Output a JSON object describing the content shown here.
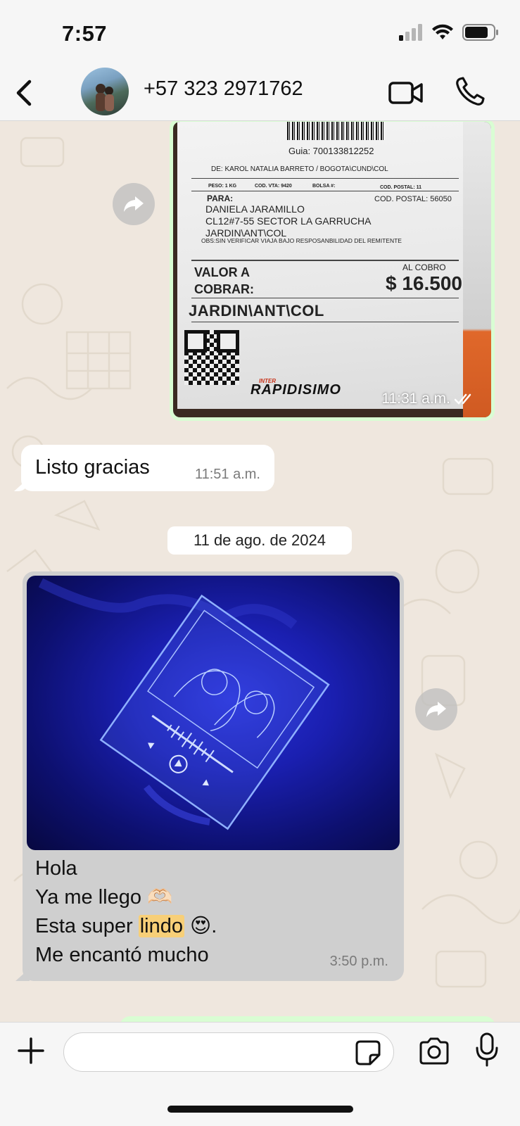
{
  "status_bar": {
    "time": "7:57"
  },
  "header": {
    "contact": "+57 323 2971762"
  },
  "messages": {
    "receipt": {
      "guia": "Guia:  700133812252",
      "de": "DE:  KAROL NATALIA BARRETO  / BOGOTA\\CUND\\COL",
      "peso": "PESO:  1 KG",
      "cod_vta": "COD. VTA: 9420",
      "bolsa": "BOLSA #:",
      "cod_postal_small": "COD. POSTAL: 11",
      "para": "PARA:",
      "cod_postal": "COD. POSTAL: 56050",
      "address": [
        "DANIELA JARAMILLO",
        "CL12#7-55 SECTOR LA GARRUCHA",
        "JARDIN\\ANT\\COL"
      ],
      "obs": "OBS:SIN VERIFICAR VIAJA BAJO RESPOSANBILIDAD DEL REMITENTE",
      "valor": "VALOR A",
      "cobrar": "COBRAR:",
      "al_cobro": "AL COBRO",
      "amount": "$ 16.500",
      "dest": "JARDIN\\ANT\\COL",
      "brand_small": "INTER",
      "brand": "RAPIDISIMO",
      "time": "11:31 a.m."
    },
    "reply": {
      "text": "Listo gracias",
      "time": "11:51 a.m."
    },
    "date_separator": "11 de ago. de 2024",
    "photo_msg": {
      "lines": [
        "Hola",
        "Ya me llego 🫶🏻",
        "Esta super",
        "lindo",
        "😍."
      ],
      "last_line": "Me encantó mucho",
      "time": "3:50 p.m."
    }
  },
  "composer": {
    "placeholder": ""
  },
  "colors": {
    "outgoing": "#d9fdd3",
    "incoming": "#ffffff",
    "chat_bg": "#efe7de",
    "photo_bubble": "#cfcfcf"
  }
}
